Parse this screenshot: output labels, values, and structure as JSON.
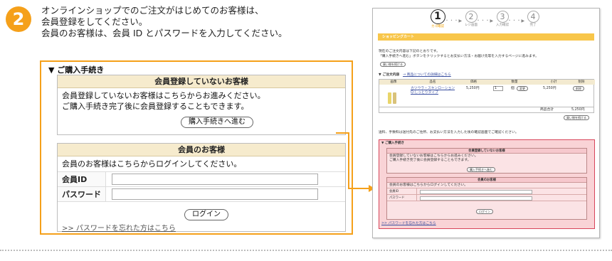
{
  "step_number": "2",
  "intro": {
    "line1": "オンラインショップでのご注文がはじめてのお客様は、",
    "line2": "会員登録をしてください。",
    "line3": "会員のお客様は、会員 ID とパスワードを入力してください。"
  },
  "zoom_panel": {
    "section_title": "▼ ご購入手続き",
    "guest": {
      "header": "会員登録していないお客様",
      "line1": "会員登録していないお客様はこちらからお進みください。",
      "line2": "ご購入手続き完了後に会員登録することもできます。",
      "button": "購入手続きへ進む"
    },
    "member": {
      "header": "会員のお客様",
      "message": "会員のお客様はこちらからログインしてください。",
      "id_label": "会員ID",
      "password_label": "パスワード",
      "login_button": "ログイン",
      "forgot_link": ">> パスワードを忘れた方はこちら"
    }
  },
  "mini": {
    "steps": [
      {
        "num": "1",
        "label": "カゴ確認"
      },
      {
        "num": "2",
        "label": "レジ画面"
      },
      {
        "num": "3",
        "label": "入力確認"
      },
      {
        "num": "4",
        "label": "完了"
      }
    ],
    "cart_title": "ショッピングカート",
    "msg1": "現在のご注文内容は下記のとおりです。",
    "msg2": "「購入手続きへ進む」ボタンをクリックするとお支払い方法・お届け先等を入力するページに進みます。",
    "continue_button": "買い物を続ける",
    "order_title": "▼ ご注文内容",
    "detail_link": "→ 商品についての詳細はこちら",
    "columns": [
      "画像",
      "品名",
      "価格",
      "数量",
      "小計",
      "削除"
    ],
    "item_name1": "カツウラ・スキンローション",
    "item_name2": "Q:しっとりタイプ",
    "item_price": "5,250円",
    "item_qty": "1",
    "qty_unit": "個",
    "change_button": "変更",
    "item_subtotal": "5,250円",
    "delete_button": "削除",
    "total_label": "商品合計",
    "total_value": "5,250円",
    "shipping_note": "送料、手数料は送付先のご住所、お支払い方法を入力した後の確認画面でご確認ください。",
    "purchase_title": "▼ ご購入手続き",
    "guest_header": "会員登録していないお客様",
    "guest_line1": "会員登録していないお客様はこちらからお進みください。",
    "guest_line2": "ご購入手続き完了後に会員登録することもできます。",
    "guest_button": "購入手続きへ進む",
    "member_header": "会員のお客様",
    "member_msg": "会員のお客様はこちらからログインしてください。",
    "id_label": "会員ID",
    "password_label": "パスワード",
    "login_button": "ログイン",
    "forgot_link": ">> パスワードを忘れた方はこちら"
  },
  "colors": {
    "accent_orange": "#f5a01a",
    "highlight_pink": "#f9d3d6",
    "highlight_border": "#d8455a",
    "header_beige": "#f6ebcd"
  }
}
